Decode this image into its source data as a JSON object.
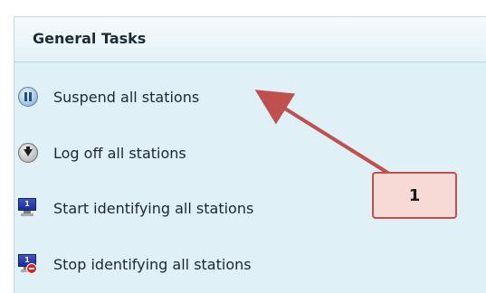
{
  "panel": {
    "title": "General Tasks"
  },
  "tasks": [
    {
      "label": "Suspend all stations",
      "icon": "pause-icon"
    },
    {
      "label": "Log off all stations",
      "icon": "logoff-icon"
    },
    {
      "label": "Start identifying all stations",
      "icon": "monitor-icon",
      "badge": "1"
    },
    {
      "label": "Stop identifying all stations",
      "icon": "monitor-stop-icon",
      "badge": "1"
    }
  ],
  "callout": {
    "text": "1"
  },
  "colors": {
    "panel_bg": "#dff0f6",
    "callout_bg": "#f7d9d6",
    "callout_border": "#c0504d",
    "arrow": "#c0504d"
  }
}
